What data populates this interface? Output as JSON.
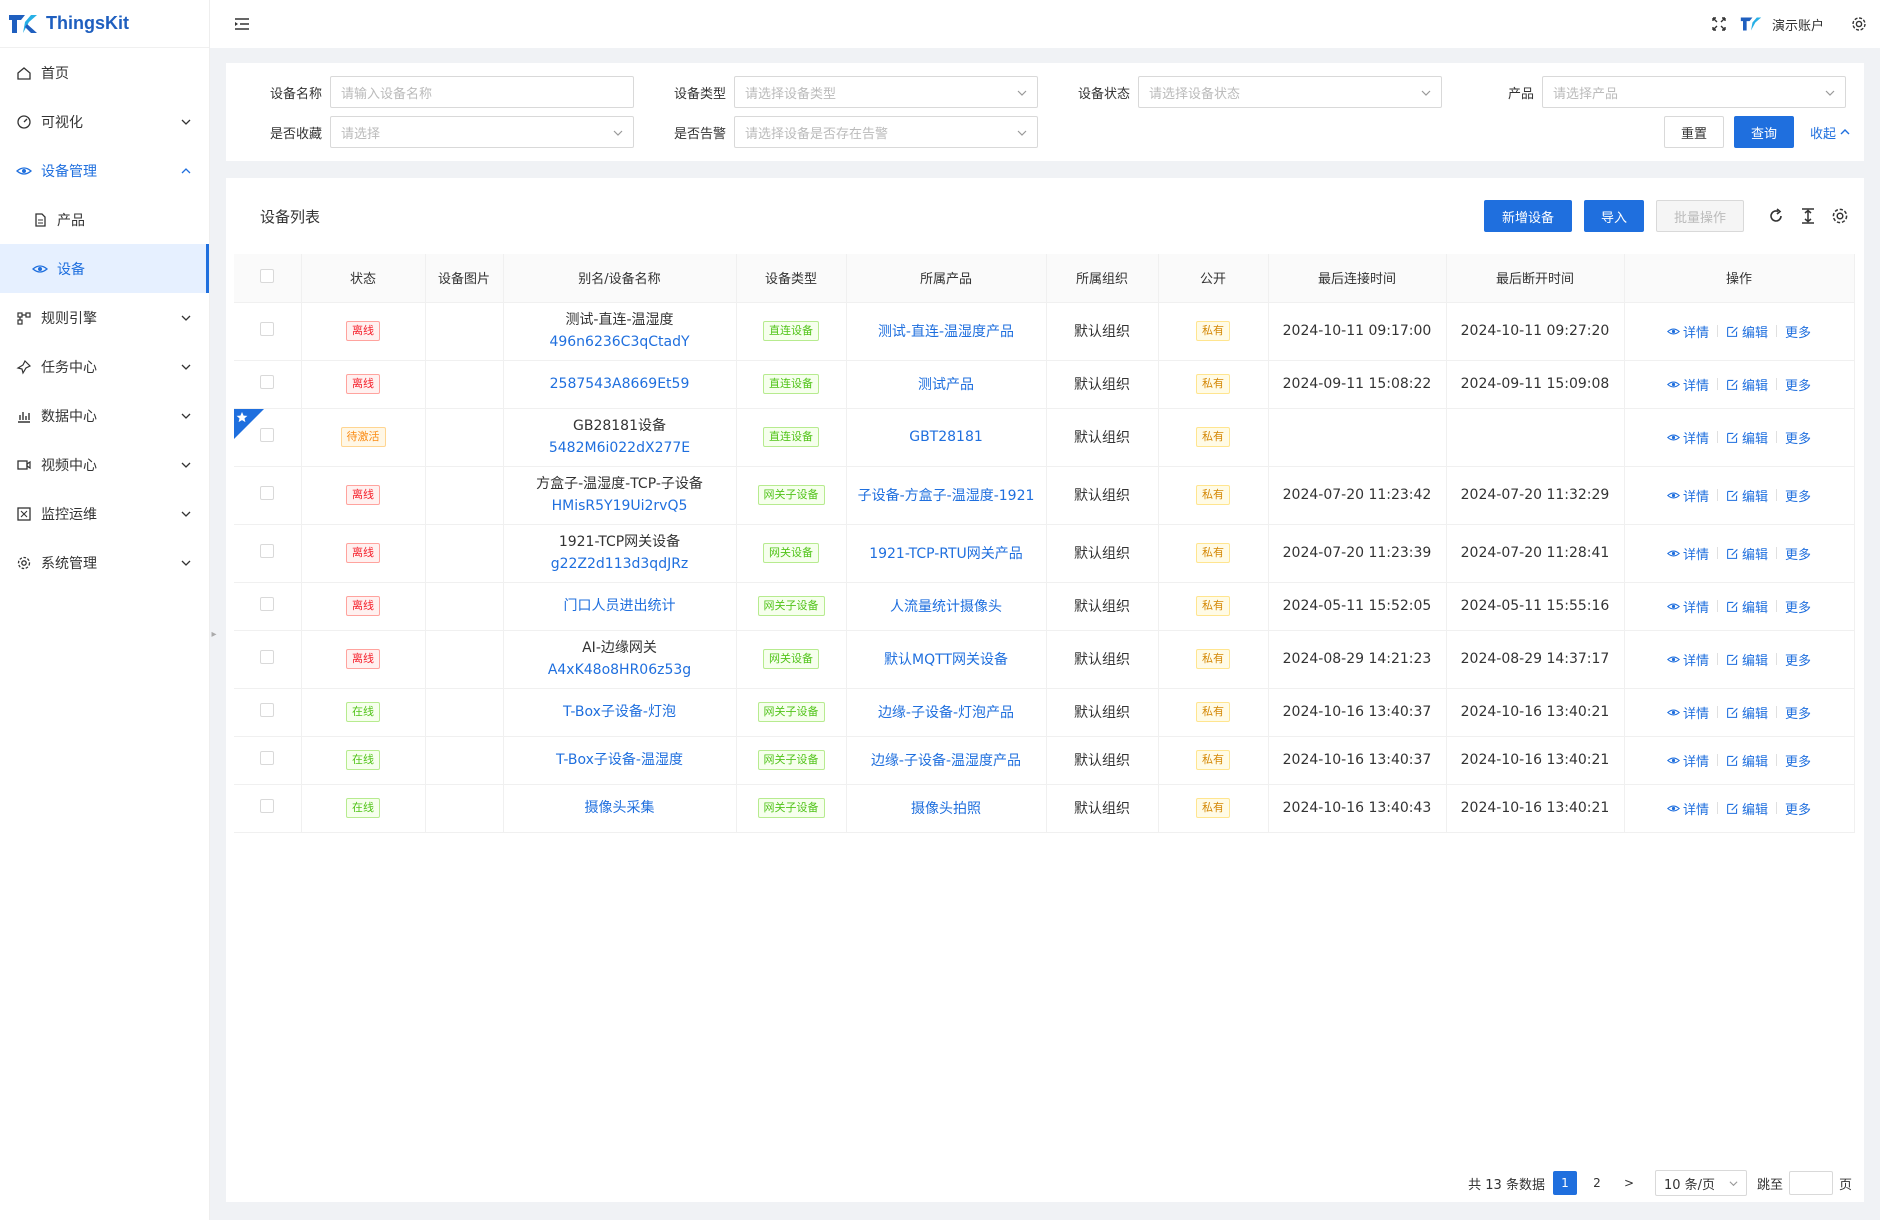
{
  "app": {
    "name": "ThingsKit",
    "user": "演示账户"
  },
  "sidebar": {
    "items": [
      {
        "label": "首页",
        "icon": "home-icon",
        "chev": false
      },
      {
        "label": "可视化",
        "icon": "dashboard-icon",
        "chev": true
      },
      {
        "label": "设备管理",
        "icon": "eye-icon",
        "chev": true,
        "open": true
      },
      {
        "label": "产品",
        "icon": "file-icon",
        "sub": true
      },
      {
        "label": "设备",
        "icon": "eye-icon",
        "sub": true,
        "active": true
      },
      {
        "label": "规则引擎",
        "icon": "flow-icon",
        "chev": true
      },
      {
        "label": "任务中心",
        "icon": "pin-icon",
        "chev": true
      },
      {
        "label": "数据中心",
        "icon": "chart-icon",
        "chev": true
      },
      {
        "label": "视频中心",
        "icon": "video-icon",
        "chev": true
      },
      {
        "label": "监控运维",
        "icon": "monitor-icon",
        "chev": true
      },
      {
        "label": "系统管理",
        "icon": "gear-icon",
        "chev": true
      }
    ]
  },
  "filters": {
    "device_name": {
      "label": "设备名称",
      "placeholder": "请输入设备名称"
    },
    "device_type": {
      "label": "设备类型",
      "placeholder": "请选择设备类型"
    },
    "device_status": {
      "label": "设备状态",
      "placeholder": "请选择设备状态"
    },
    "product": {
      "label": "产品",
      "placeholder": "请选择产品"
    },
    "favorite": {
      "label": "是否收藏",
      "placeholder": "请选择"
    },
    "alarm": {
      "label": "是否告警",
      "placeholder": "请选择设备是否存在告警"
    },
    "reset_label": "重置",
    "query_label": "查询",
    "collapse_label": "收起"
  },
  "table_card": {
    "title": "设备列表",
    "add_label": "新增设备",
    "import_label": "导入",
    "batch_label": "批量操作"
  },
  "columns": [
    "状态",
    "设备图片",
    "别名/设备名称",
    "设备类型",
    "所属产品",
    "所属组织",
    "公开",
    "最后连接时间",
    "最后断开时间",
    "操作"
  ],
  "rows": [
    {
      "status": "离线",
      "status_color": "red",
      "alias": "测试-直连-温湿度",
      "name": "496n6236C3qCtadY",
      "type": "直连设备",
      "product": "测试-直连-温湿度产品",
      "org": "默认组织",
      "public": "私有",
      "connect": "2024-10-11 09:17:00",
      "disconnect": "2024-10-11 09:27:20"
    },
    {
      "status": "离线",
      "status_color": "red",
      "alias": "",
      "name": "2587543A8669Et59",
      "type": "直连设备",
      "product": "测试产品",
      "org": "默认组织",
      "public": "私有",
      "connect": "2024-09-11 15:08:22",
      "disconnect": "2024-09-11 15:09:08"
    },
    {
      "status": "待激活",
      "status_color": "orange",
      "alias": "GB28181设备",
      "name": "5482M6i022dX277E",
      "type": "直连设备",
      "product": "GBT28181",
      "org": "默认组织",
      "public": "私有",
      "connect": "",
      "disconnect": "",
      "starred": true
    },
    {
      "status": "离线",
      "status_color": "red",
      "alias": "方盒子-温湿度-TCP-子设备",
      "name": "HMisR5Y19Ui2rvQ5",
      "type": "网关子设备",
      "product": "子设备-方盒子-温湿度-1921",
      "org": "默认组织",
      "public": "私有",
      "connect": "2024-07-20 11:23:42",
      "disconnect": "2024-07-20 11:32:29"
    },
    {
      "status": "离线",
      "status_color": "red",
      "alias": "1921-TCP网关设备",
      "name": "g22Z2d113d3qdJRz",
      "type": "网关设备",
      "product": "1921-TCP-RTU网关产品",
      "org": "默认组织",
      "public": "私有",
      "connect": "2024-07-20 11:23:39",
      "disconnect": "2024-07-20 11:28:41"
    },
    {
      "status": "离线",
      "status_color": "red",
      "alias": "",
      "name": "门口人员进出统计",
      "type": "网关子设备",
      "product": "人流量统计摄像头",
      "org": "默认组织",
      "public": "私有",
      "connect": "2024-05-11 15:52:05",
      "disconnect": "2024-05-11 15:55:16"
    },
    {
      "status": "离线",
      "status_color": "red",
      "alias": "AI-边缘网关",
      "name": "A4xK48o8HR06z53g",
      "type": "网关设备",
      "product": "默认MQTT网关设备",
      "org": "默认组织",
      "public": "私有",
      "connect": "2024-08-29 14:21:23",
      "disconnect": "2024-08-29 14:37:17"
    },
    {
      "status": "在线",
      "status_color": "green",
      "alias": "",
      "name": "T-Box子设备-灯泡",
      "type": "网关子设备",
      "product": "边缘-子设备-灯泡产品",
      "org": "默认组织",
      "public": "私有",
      "connect": "2024-10-16 13:40:37",
      "disconnect": "2024-10-16 13:40:21"
    },
    {
      "status": "在线",
      "status_color": "green",
      "alias": "",
      "name": "T-Box子设备-温湿度",
      "type": "网关子设备",
      "product": "边缘-子设备-温湿度产品",
      "org": "默认组织",
      "public": "私有",
      "connect": "2024-10-16 13:40:37",
      "disconnect": "2024-10-16 13:40:21"
    },
    {
      "status": "在线",
      "status_color": "green",
      "alias": "",
      "name": "摄像头采集",
      "type": "网关子设备",
      "product": "摄像头拍照",
      "org": "默认组织",
      "public": "私有",
      "connect": "2024-10-16 13:40:43",
      "disconnect": "2024-10-16 13:40:21"
    }
  ],
  "ops": {
    "detail": "详情",
    "edit": "编辑",
    "more": "更多"
  },
  "pager": {
    "total": "共 13 条数据",
    "pages": [
      "1",
      "2"
    ],
    "current": "1",
    "next": ">",
    "page_size": "10 条/页",
    "jump_label": "跳至",
    "page_suffix": "页"
  },
  "colors": {
    "primary": "#1f6fde",
    "offline": "#f5222d",
    "pending": "#fa8c16",
    "online": "#52c41a"
  }
}
